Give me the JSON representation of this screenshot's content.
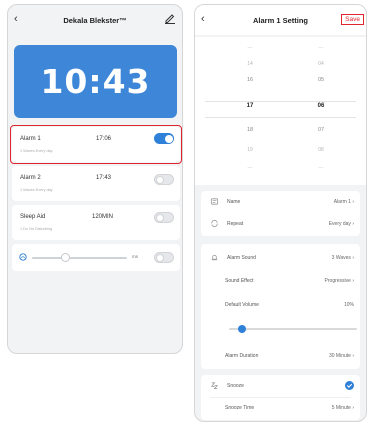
{
  "left_screen": {
    "title": "Dekala Blekster™",
    "back_icon": "chevron-left-icon",
    "edit_icon": "pencil-icon",
    "clock": "10:43",
    "alarms": [
      {
        "name": "Alarm 1",
        "time": "17:06",
        "sub": "1 Waves Every day",
        "enabled": true
      },
      {
        "name": "Alarm 2",
        "time": "17:43",
        "sub": "1 Waves Every day",
        "enabled": false
      }
    ],
    "sleep_aid": {
      "name": "Sleep Aid",
      "duration": "120MIN",
      "sub": "1 Do No Disturbing",
      "enabled": false
    },
    "volume": {
      "label": "ms",
      "level": 0.35,
      "enabled": false
    },
    "accent": "#3d86d8",
    "highlight_color": "#e0262d"
  },
  "right_screen": {
    "title": "Alarm 1 Setting",
    "save_label": "Save",
    "picker": {
      "rows": [
        {
          "hour": "—",
          "minute": "—"
        },
        {
          "hour": "14",
          "minute": "04"
        },
        {
          "hour": "16",
          "minute": "05"
        },
        {
          "hour": "17",
          "minute": "06"
        },
        {
          "hour": "18",
          "minute": "07"
        },
        {
          "hour": "19",
          "minute": "08"
        },
        {
          "hour": "—",
          "minute": "—"
        }
      ]
    },
    "settings": {
      "name_label": "Name",
      "name_value": "Alarm 1 ›",
      "repeat_label": "Repeat",
      "repeat_value": "Every day ›",
      "alarm_sound_label": "Alarm Sound",
      "alarm_sound_value": "3 Waves ›",
      "sound_effect_label": "Sound Effect",
      "sound_effect_value": "Progressive ›",
      "default_volume_label": "Default Volume",
      "default_volume_value": "10%",
      "default_volume_level": 0.1,
      "alarm_duration_label": "Alarm Duration",
      "alarm_duration_value": "30 Minute ›",
      "snooze_label": "Snooze",
      "snooze_enabled": true,
      "snooze_time_label": "Snooze Time",
      "snooze_time_value": "5 Minute ›"
    }
  }
}
